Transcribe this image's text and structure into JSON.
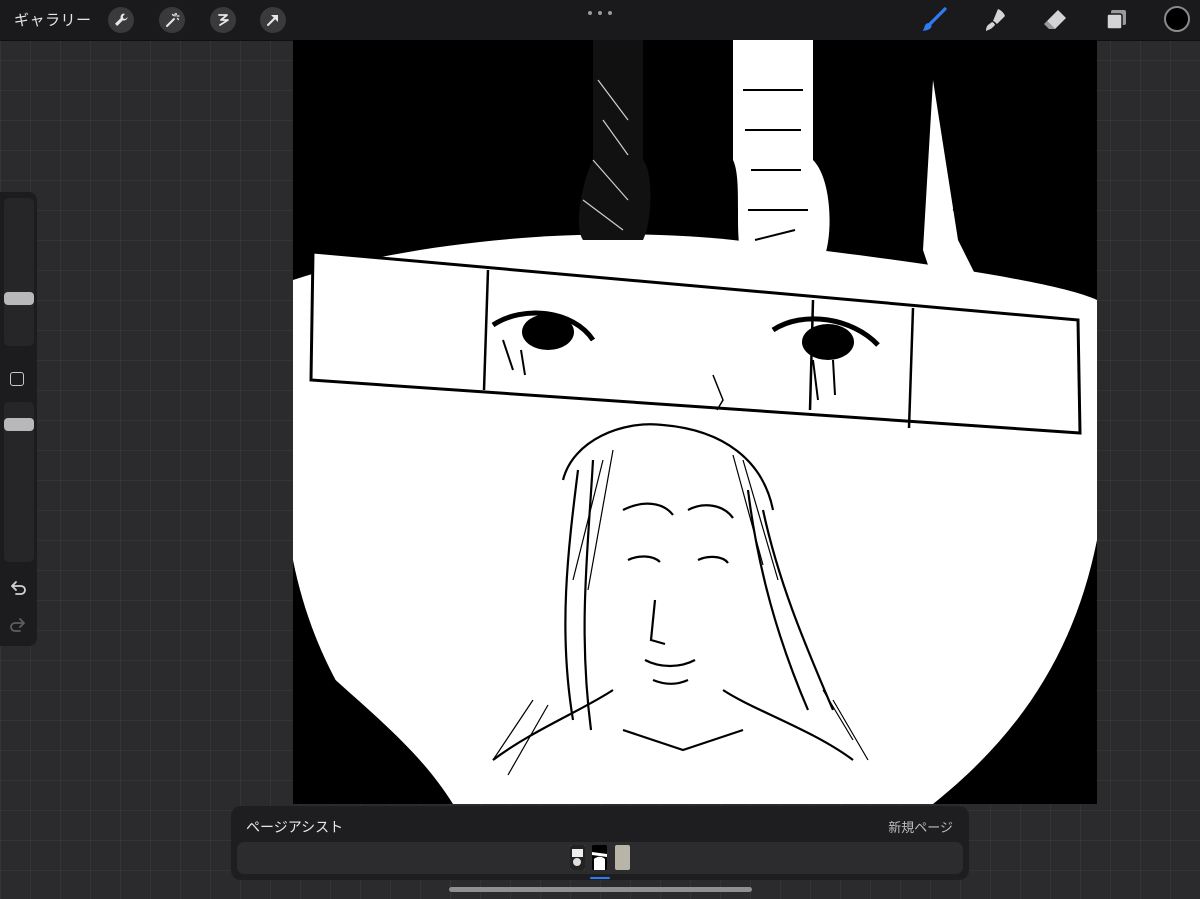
{
  "toolbar": {
    "gallery_label": "ギャラリー",
    "left_tools": [
      "wrench-icon",
      "magic-wand-icon",
      "selection-icon",
      "transform-arrow-icon"
    ],
    "right_tools": [
      "brush-icon",
      "smudge-icon",
      "eraser-icon",
      "layers-icon"
    ],
    "active_tool": "brush-icon",
    "current_color": "#000000",
    "accent_color": "#2f7bf6"
  },
  "sidebar": {
    "brush_size_level": 0.28,
    "opacity_level": 0.85,
    "buttons": [
      "modify-square-icon",
      "undo-icon",
      "redo-icon"
    ]
  },
  "page_assist": {
    "title": "ページアシスト",
    "new_page_label": "新規ページ",
    "pages": [
      {
        "name": "page-1",
        "selected": false
      },
      {
        "name": "page-2",
        "selected": true
      },
      {
        "name": "page-3",
        "selected": false
      }
    ]
  }
}
